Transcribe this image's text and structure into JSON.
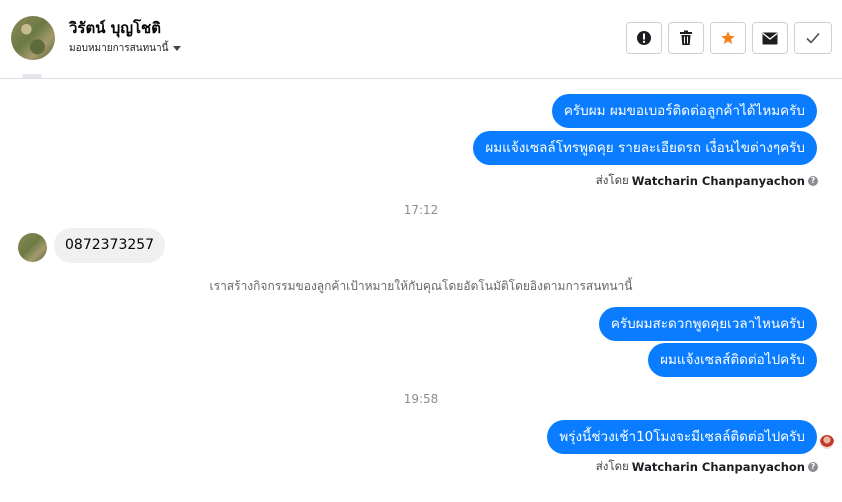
{
  "header": {
    "contact_name": "วิรัตน์ บุญโชติ",
    "assign_label": "มอบหมายการสนทนานี้",
    "actions": [
      {
        "name": "mark-spam-button",
        "icon": "alert-icon"
      },
      {
        "name": "delete-button",
        "icon": "trash-icon"
      },
      {
        "name": "star-button",
        "icon": "star-icon"
      },
      {
        "name": "mark-unread-button",
        "icon": "envelope-icon"
      },
      {
        "name": "mark-done-button",
        "icon": "check-icon"
      }
    ]
  },
  "messages": {
    "out_1": "ครับผม ผมขอเบอร์ติดต่อลูกค้าได้ไหมครับ",
    "out_2": "ผมแจ้งเซลล์โทรพูดคุย รายละเอียดรถ เงื่อนไขต่างๆครับ",
    "sent_by_1_prefix": "ส่งโดย",
    "sent_by_1_name": "Watcharin Chanpanyachon",
    "time_1": "17:12",
    "in_1": "0872373257",
    "system_note": "เราสร้างกิจกรรมของลูกค้าเป้าหมายให้กับคุณโดยอัตโนมัติโดยอิงตามการสนทนานี้",
    "out_3": "ครับผมสะดวกพูดคุยเวลาไหนครับ",
    "out_4": "ผมแจ้งเซลส์ติดต่อไปครับ",
    "time_2": "19:58",
    "out_5": "พรุ่งนี้ช่วงเช้า10โมงจะมีเซลล์ติดต่อไปครับ",
    "sent_by_2_prefix": "ส่งโดย",
    "sent_by_2_name": "Watcharin Chanpanyachon"
  },
  "colors": {
    "outgoing_bubble": "#0a7cff",
    "incoming_bubble": "#f0f0f0",
    "star": "#f5821f"
  }
}
